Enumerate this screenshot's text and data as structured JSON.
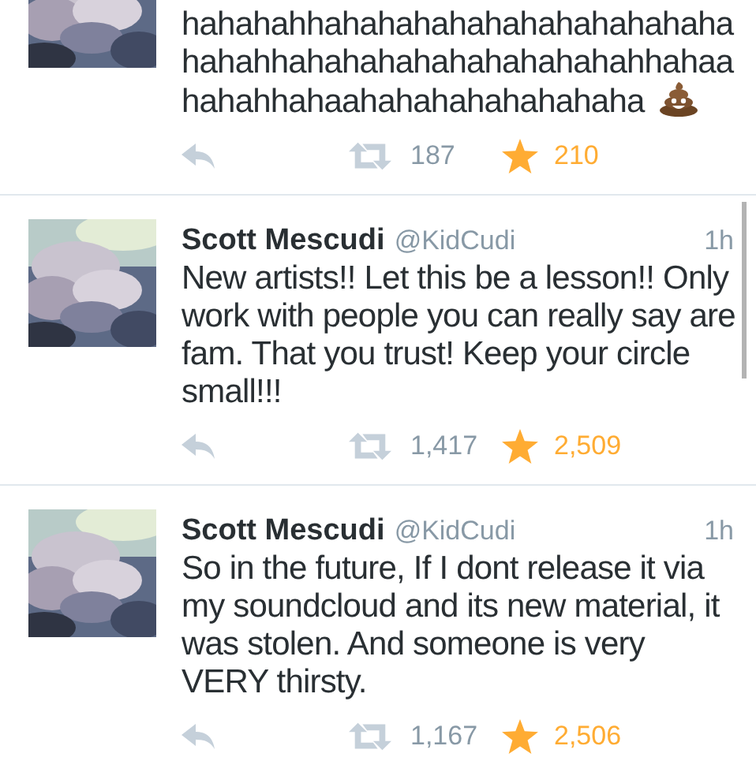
{
  "tweets": [
    {
      "text": "hahahahhahahahahahahahahahahaha hahahhahahahahahahahahahahhahaa hahahhahaahahahahahahahaha",
      "ends_with_emoji": true,
      "retweets": "187",
      "favorites": "210"
    },
    {
      "name": "Scott Mescudi",
      "handle": "@KidCudi",
      "time": "1h",
      "text": "New artists!! Let this be a lesson!! Only work with people you can really say are fam. That you trust! Keep your circle small!!!",
      "retweets": "1,417",
      "favorites": "2,509"
    },
    {
      "name": "Scott Mescudi",
      "handle": "@KidCudi",
      "time": "1h",
      "text": "So in the future, If I dont release it via my soundcloud and its new material, it was stolen.  And someone is very VERY thirsty.",
      "retweets": "1,167",
      "favorites": "2,506"
    }
  ]
}
